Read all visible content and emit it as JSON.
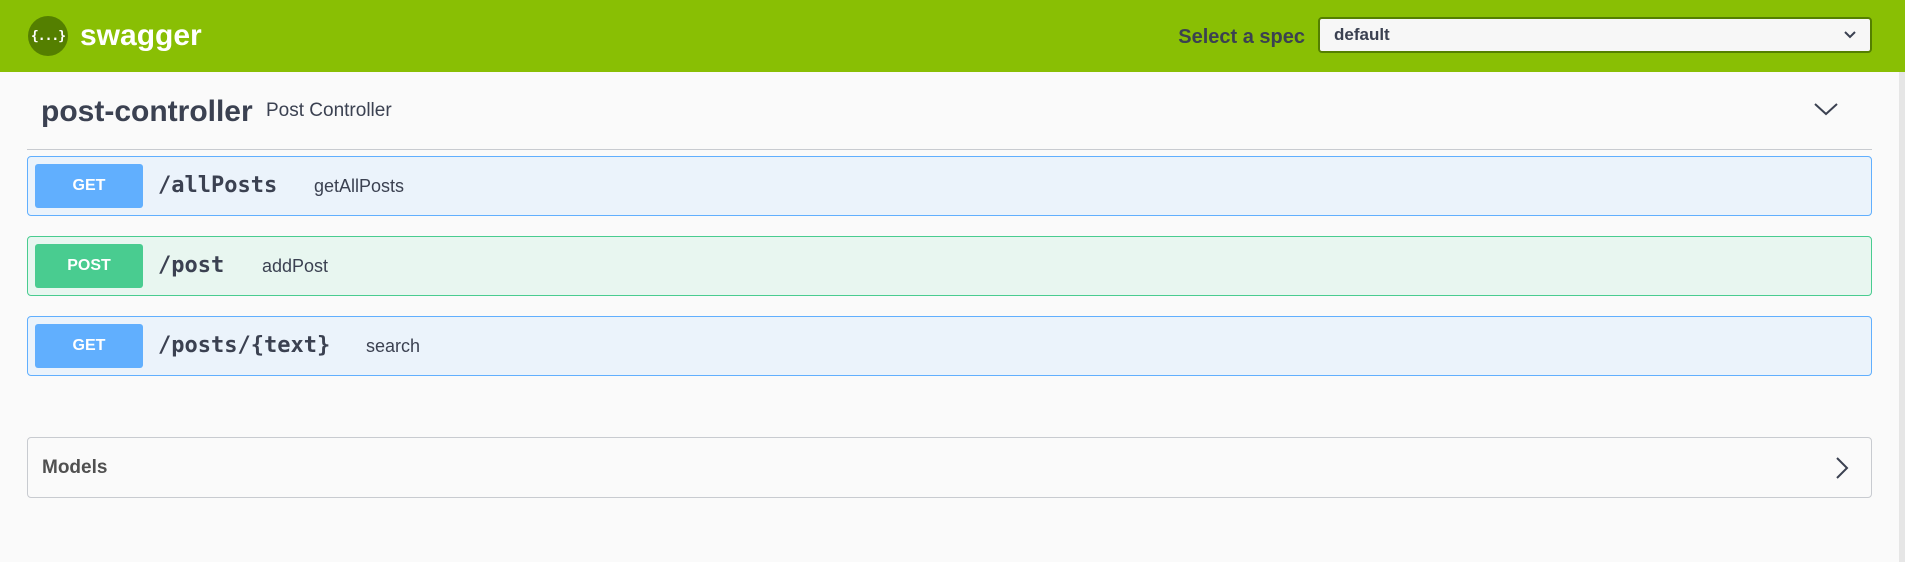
{
  "topbar": {
    "logo_glyph": "{...}",
    "logo_text": "swagger",
    "spec_label": "Select a spec",
    "spec_value": "default",
    "colors": {
      "background": "#89bf04",
      "logo_circle": "#547f00"
    }
  },
  "tag": {
    "name": "post-controller",
    "description": "Post Controller",
    "toggle_icon": "chevron-down-icon"
  },
  "operations": [
    {
      "method": "GET",
      "path": "/allPosts",
      "summary": "getAllPosts",
      "color": "#61affe"
    },
    {
      "method": "POST",
      "path": "/post",
      "summary": "addPost",
      "color": "#49cc90"
    },
    {
      "method": "GET",
      "path": "/posts/{text}",
      "summary": "search",
      "color": "#61affe"
    }
  ],
  "models": {
    "title": "Models",
    "toggle_icon": "chevron-right-icon"
  }
}
